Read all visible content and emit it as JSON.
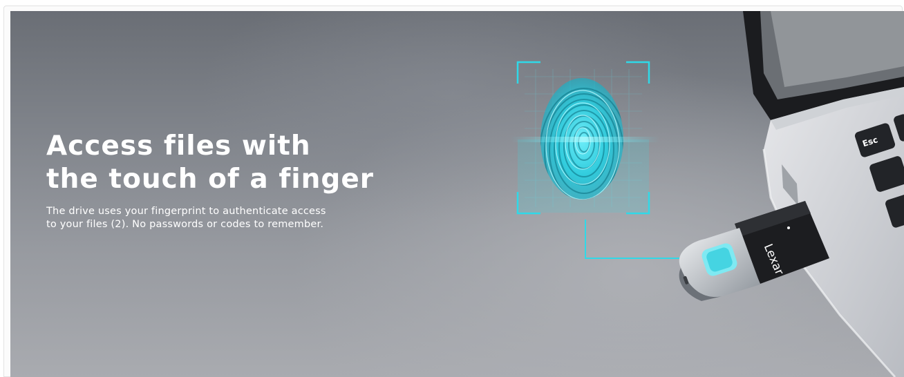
{
  "banner": {
    "headline_line1": "Access files with",
    "headline_line2": "the touch of a finger",
    "subtext_line1": "The drive uses your fingerprint to authenticate access",
    "subtext_line2": "to your files (2). No passwords or codes to remember."
  },
  "drive": {
    "brand": "Lexar"
  },
  "laptop": {
    "esc_key": "Esc"
  },
  "colors": {
    "accent": "#2fd9e8",
    "background": "#8a8d93",
    "text": "#ffffff"
  }
}
